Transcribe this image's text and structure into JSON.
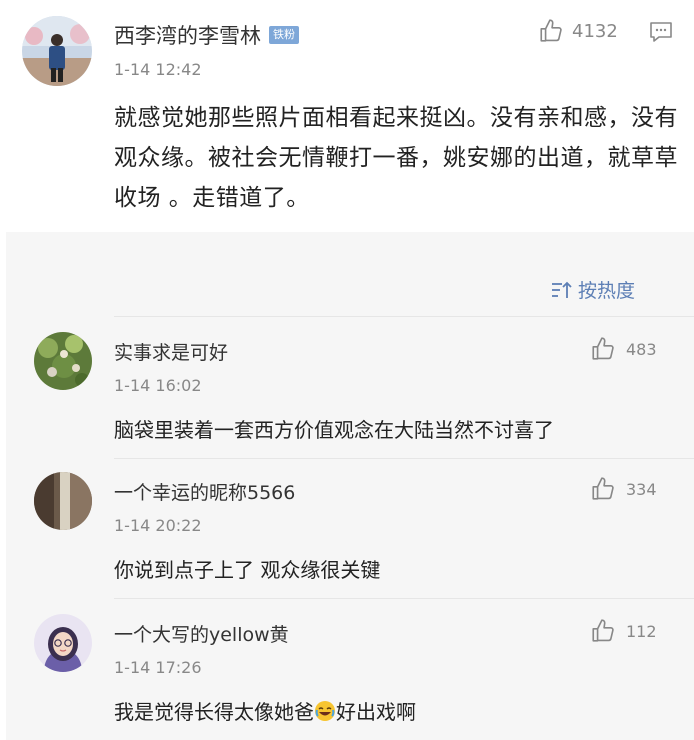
{
  "main_comment": {
    "username": "西李湾的李雪林",
    "badge": "铁粉",
    "time": "1-14 12:42",
    "likes": "4132",
    "text": "就感觉她那些照片面相看起来挺凶。没有亲和感，没有观众缘。被社会无情鞭打一番，姚安娜的出道，就草草收场 。走错道了。",
    "colors": {
      "badge": "#7ea7d8",
      "accent": "#5d7fb5"
    }
  },
  "sort": {
    "label": "按热度",
    "icon": "sort-icon"
  },
  "replies": [
    {
      "username": "实事求是可好",
      "time": "1-14 16:02",
      "likes": "483",
      "text": "脑袋里装着一套西方价值观念在大陆当然不讨喜了"
    },
    {
      "username": "一个幸运的昵称5566",
      "time": "1-14 20:22",
      "likes": "334",
      "text": "你说到点子上了 观众缘很关键"
    },
    {
      "username": "一个大写的yellow黄",
      "time": "1-14 17:26",
      "likes": "112",
      "text_before": "我是觉得长得太像她爸",
      "emoji": "laughing-crying-emoji",
      "text_after": "好出戏啊"
    }
  ]
}
